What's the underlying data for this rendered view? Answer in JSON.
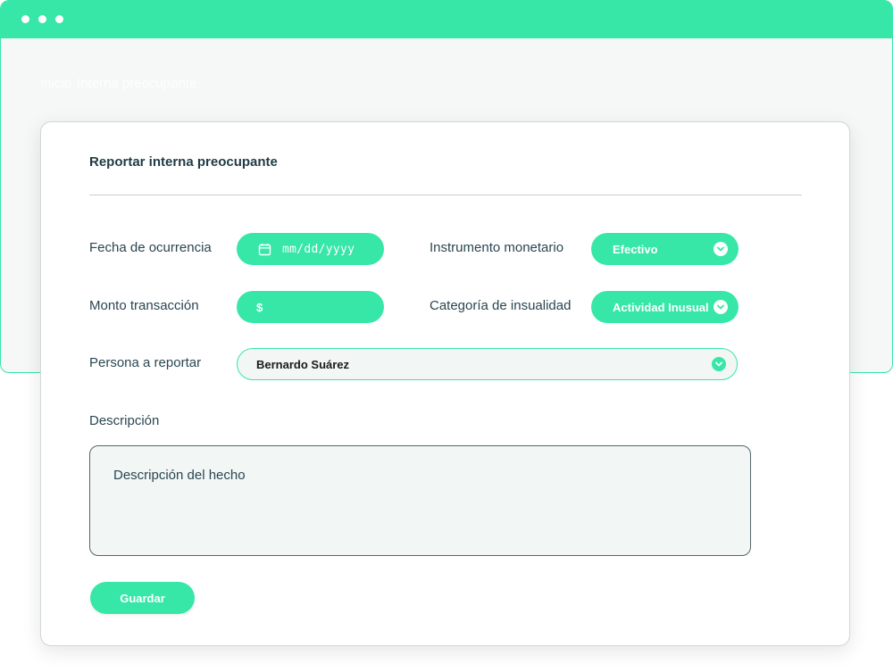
{
  "colors": {
    "accent": "#36e7a7",
    "text": "#2a4651",
    "field_bg": "#f2f6f5"
  },
  "breadcrumb": {
    "home": "Inicio",
    "current": "Interna preocupante"
  },
  "form": {
    "title": "Reportar interna preocupante",
    "fields": {
      "date_label": "Fecha de ocurrencia",
      "date_placeholder": "mm/dd/yyyy",
      "instrument_label": "Instrumento monetario",
      "instrument_value": "Efectivo",
      "amount_label": "Monto transacción",
      "amount_prefix": "$",
      "category_label": "Categoría de insualidad",
      "category_value": "Actividad Inusual",
      "person_label": "Persona a reportar",
      "person_value": "Bernardo Suárez",
      "description_label": "Descripción",
      "description_placeholder": "Descripción del hecho"
    },
    "save_label": "Guardar"
  },
  "icons": {
    "date": "calendar-icon",
    "dropdown": "chevron-down-icon"
  }
}
